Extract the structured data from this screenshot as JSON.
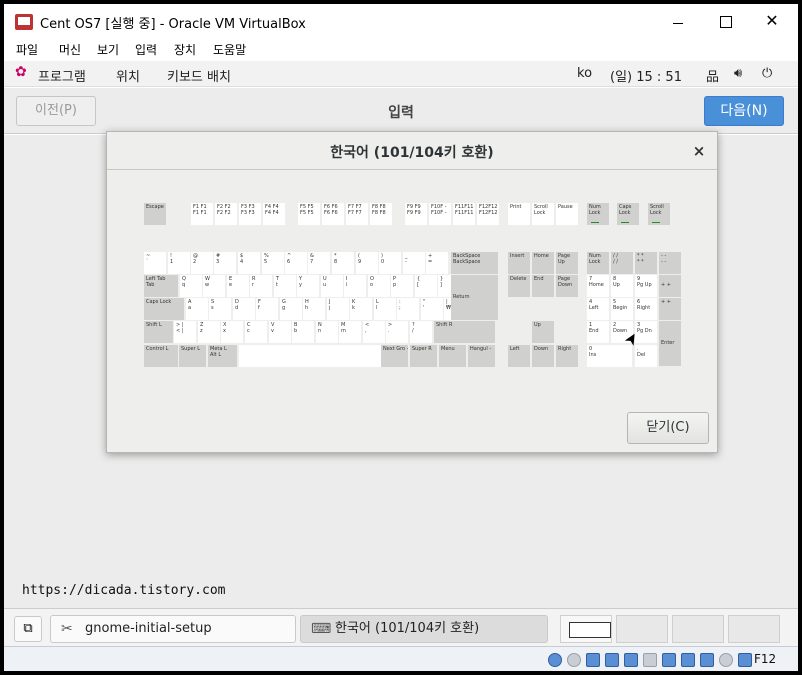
{
  "window": {
    "title": "Cent OS7 [실행 중] - Oracle VM VirtualBox"
  },
  "vbox_menu": [
    "파일",
    "머신",
    "보기",
    "입력",
    "장치",
    "도움말"
  ],
  "gnome_panel": {
    "apps_label": "프로그램",
    "places_label": "위치",
    "layout_label": "키보드 배치",
    "input_method": "ko",
    "clock": "(일) 15 : 51",
    "icons": [
      "network-icon",
      "volume-icon",
      "power-icon"
    ]
  },
  "setup": {
    "prev_label": "이전(P)",
    "title": "입력",
    "next_label": "다음(N)",
    "next_color": "#4a90d9"
  },
  "dialog": {
    "title": "한국어 (101/104키 호환)",
    "close_symbol": "×",
    "close_button_label": "닫기(C)"
  },
  "keyboard": {
    "row_f": [
      "Escape",
      "F1 F1\nF1 F1",
      "F2 F2\nF2 F2",
      "F3 F3\nF3 F3",
      "F4 F4\nF4 F4",
      "F5 F5\nF5 F5",
      "F6 F6\nF6 F6",
      "F7 F7\nF7 F7",
      "F8 F8\nF8 F8",
      "F9 F9\nF9 F9",
      "F10F -\nF10F -",
      "F11F11\nF11F11",
      "F12F12\nF12F12",
      "Print",
      "Scroll\nLock",
      "Pause",
      "Num\nLock",
      "Caps\nLock",
      "Scroll\nLock"
    ],
    "row_num": [
      "~\n`",
      "!\n1",
      "@\n2",
      "#\n3",
      "$\n4",
      "%\n5",
      "^\n6",
      "&\n7",
      "*\n8",
      "(\n9",
      ")\n0",
      "_\n-",
      "+\n=",
      "BackSpace\nBackSpace",
      "Insert",
      "Home",
      "Page\nUp",
      "Num\nLock",
      "/ /\n/ /",
      "* *\n* *",
      "- -\n- -"
    ],
    "row_q": [
      "Left Tab\nTab",
      "Q\nq",
      "W\nw",
      "E\ne",
      "R\nr",
      "T\nt",
      "Y\ny",
      "U\nu",
      "I\ni",
      "O\no",
      "P\np",
      "{\n[",
      "}\n]",
      "Return",
      "Delete",
      "End",
      "Page\nDown",
      "7\nHome",
      "8\nUp",
      "9\nPg Up",
      "+ +"
    ],
    "row_a": [
      "Caps Lock",
      "A\na",
      "S\ns",
      "D\nd",
      "F\nf",
      "G\ng",
      "H\nh",
      "J\nj",
      "K\nk",
      "L\nl",
      ":\n;",
      "\"\n'",
      "|\n₩",
      "4\nLeft",
      "5\nBegin",
      "6\nRight",
      "+ +"
    ],
    "row_z": [
      "Shift L",
      "> |\n< |",
      "Z\nz",
      "X\nx",
      "C\nc",
      "V\nv",
      "B\nb",
      "N\nn",
      "M\nm",
      "<\n,",
      ">\n.",
      "?\n/",
      "Shift R",
      "Up",
      "1\nEnd",
      "2\nDown",
      "3\nPg Dn",
      "Enter"
    ],
    "row_bottom": [
      "Control L",
      "Super L",
      "Meta L\nAlt L",
      "",
      "Next Gro -",
      "Super R",
      "Menu",
      "Hangul -",
      "Left",
      "Down",
      "Right",
      "0\nIns",
      ".\nDel"
    ]
  },
  "watermark": "https://dicada.tistory.com",
  "taskbar": {
    "task1": "gnome-initial-setup",
    "task2": "한국어 (101/104키 호환)",
    "workspaces": 4
  },
  "statusbar": {
    "host_key": "F12"
  }
}
